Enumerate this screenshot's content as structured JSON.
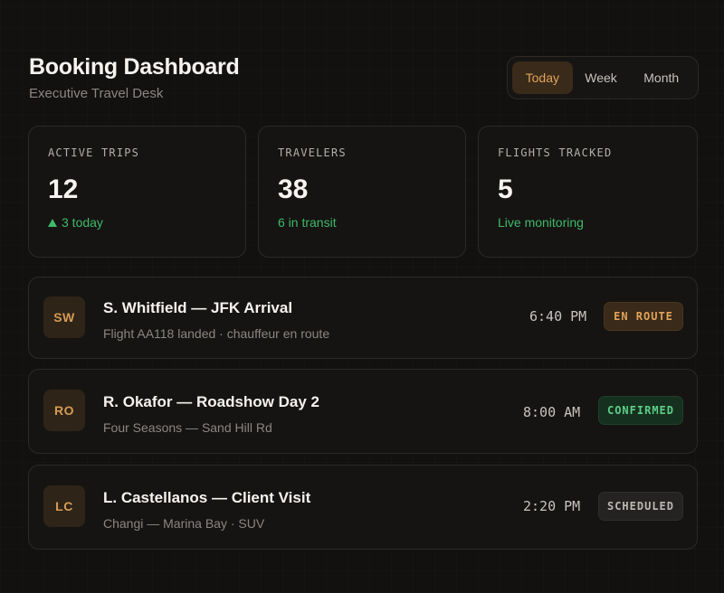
{
  "header": {
    "title": "Booking Dashboard",
    "subtitle": "Executive Travel Desk"
  },
  "range": {
    "options": [
      "Today",
      "Week",
      "Month"
    ],
    "selected": "Today"
  },
  "stats": [
    {
      "label": "ACTIVE TRIPS",
      "value": "12",
      "note": "3 today",
      "note_icon": "arrow-up-icon"
    },
    {
      "label": "TRAVELERS",
      "value": "38",
      "note": "6 in transit"
    },
    {
      "label": "FLIGHTS TRACKED",
      "value": "5",
      "note": "Live monitoring"
    }
  ],
  "bookings": [
    {
      "initials": "SW",
      "title": "S. Whitfield — JFK Arrival",
      "subtitle": "Flight AA118 landed · chauffeur en route",
      "time": "6:40 PM",
      "status": "EN ROUTE"
    },
    {
      "initials": "RO",
      "title": "R. Okafor — Roadshow Day 2",
      "subtitle": "Four Seasons — Sand Hill Rd",
      "time": "8:00 AM",
      "status": "CONFIRMED"
    },
    {
      "initials": "LC",
      "title": "L. Castellanos — Client Visit",
      "subtitle": "Changi — Marina Bay · SUV",
      "time": "2:20 PM",
      "status": "SCHEDULED"
    }
  ],
  "colors": {
    "accent": "#e0a45a",
    "success": "#3fb96a",
    "background": "#121110"
  }
}
